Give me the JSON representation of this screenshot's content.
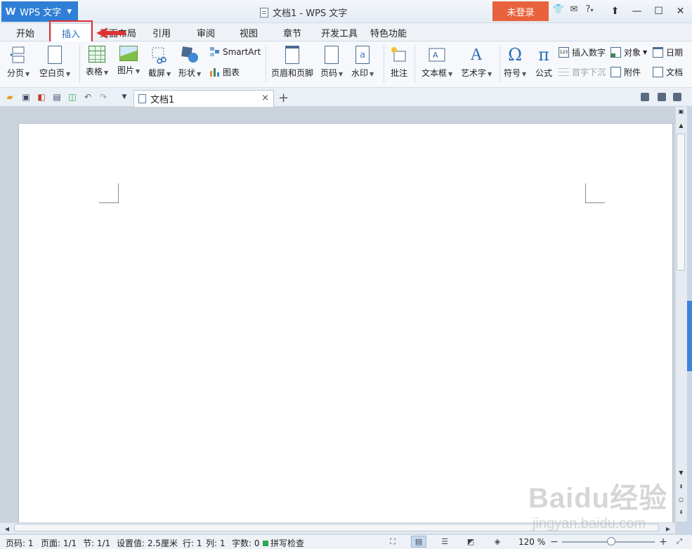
{
  "app": {
    "logo": "W",
    "name": "WPS 文字",
    "window_title": "文档1 - WPS 文字",
    "login_label": "未登录",
    "help_label": "?",
    "colors": {
      "accent": "#2f7fd6",
      "login": "#e8623e",
      "highlight_box": "#e03131"
    }
  },
  "title_icons": [
    "shirt-icon",
    "chat-icon",
    "help-icon",
    "share-icon"
  ],
  "window_controls": [
    "minimize-icon",
    "maximize-icon",
    "close-icon"
  ],
  "tabs": [
    {
      "label": "开始"
    },
    {
      "label": "插入",
      "active": true
    },
    {
      "label": "页面布局"
    },
    {
      "label": "引用"
    },
    {
      "label": "审阅"
    },
    {
      "label": "视图"
    },
    {
      "label": "章节"
    },
    {
      "label": "开发工具"
    },
    {
      "label": "特色功能"
    }
  ],
  "ribbon": {
    "page_break": "分页",
    "blank_page": "空白页",
    "table": "表格",
    "picture": "图片",
    "screenshot": "截屏",
    "shape": "形状",
    "smartart": "SmartArt",
    "chart": "图表",
    "header_footer": "页眉和页脚",
    "page_number": "页码",
    "watermark": "水印",
    "comment": "批注",
    "textbox": "文本框",
    "wordart": "艺术字",
    "symbol": "符号",
    "formula": "公式",
    "insert_number": "插入数字",
    "drop_cap": "首字下沉",
    "object": "对象",
    "attachment": "附件",
    "date": "日期",
    "document": "文档"
  },
  "doc_tab": {
    "label": "文档1",
    "close": "×",
    "add": "+"
  },
  "status": {
    "page_num": "页码: 1",
    "pages": "页面: 1/1",
    "section": "节: 1/1",
    "setting": "设置值: 2.5厘米",
    "row": "行: 1",
    "col": "列: 1",
    "word_count": "字数: 0",
    "spell_check": "拼写检查",
    "zoom": "120 %",
    "zoom_level_percent": 120
  },
  "watermark": {
    "brand": "Baidu经验",
    "url": "jingyan.baidu.com"
  }
}
